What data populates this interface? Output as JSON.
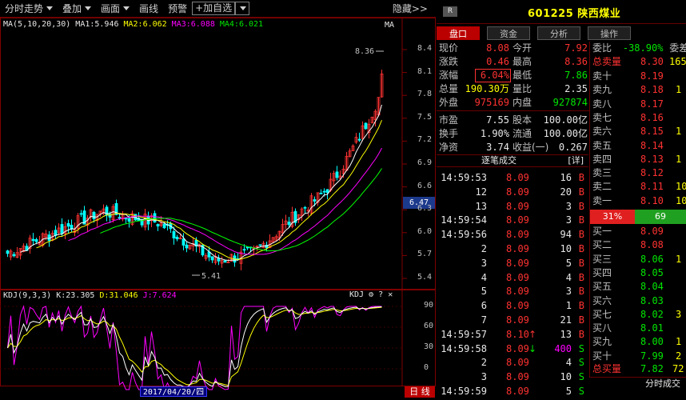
{
  "toolbar": {
    "items": [
      "分时走势",
      "叠加",
      "画面",
      "画线",
      "预警"
    ],
    "add_watch": "+加自选",
    "hide": "隐藏>>"
  },
  "chart": {
    "ma_legend": {
      "params": "MA(5,10,20,30)",
      "ma1": "MA1:5.946",
      "ma2": "MA2:6.062",
      "ma3": "MA3:6.088",
      "ma4": "MA4:6.021",
      "tag": "MA"
    },
    "price_axis": [
      "8.4",
      "8.1",
      "7.8",
      "7.5",
      "7.2",
      "6.9",
      "6.6",
      "6.3",
      "6.0",
      "5.7",
      "5.4"
    ],
    "current_price_tag": "6.47",
    "high_label": "8.36",
    "low_label": "5.41",
    "kdj_legend": {
      "params": "KDJ(9,3,3)",
      "k": "K:23.305",
      "d": "D:31.046",
      "j": "J:7.624"
    },
    "kdj_axis": [
      "90",
      "60",
      "30",
      "0"
    ],
    "date_label": "2017/04/20/四",
    "period_label": "日 线",
    "colors": {
      "ma1": "#ffffff",
      "ma2": "#ffff00",
      "ma3": "#ff00ff",
      "ma4": "#00ff00",
      "up": "#ff3232",
      "down": "#00ffff"
    }
  },
  "header": {
    "badge": "R",
    "title": "601225 陕西煤业"
  },
  "tabs": [
    "盘口",
    "资金",
    "分析",
    "操作"
  ],
  "quote": {
    "rows": [
      {
        "l1": "现价",
        "v1": "8.08",
        "l2": "今开",
        "v2": "7.92"
      },
      {
        "l1": "涨跌",
        "v1": "0.46",
        "l2": "最高",
        "v2": "8.36"
      },
      {
        "l1": "涨幅",
        "v1": "6.04%",
        "l2": "最低",
        "v2": "7.86"
      },
      {
        "l1": "总量",
        "v1": "190.30万",
        "l2": "量比",
        "v2": "2.35"
      },
      {
        "l1": "外盘",
        "v1": "975169",
        "l2": "内盘",
        "v2": "927874"
      },
      {
        "l1": "市盈",
        "v1": "7.55",
        "l2": "股本",
        "v2": "100.00亿"
      },
      {
        "l1": "换手",
        "v1": "1.90%",
        "l2": "流通",
        "v2": "100.00亿"
      },
      {
        "l1": "净资",
        "v1": "3.74",
        "l2": "收益(一)",
        "v2": "0.267"
      }
    ]
  },
  "ticks": {
    "header": "逐笔成交",
    "detail": "[详]",
    "rows": [
      {
        "time": "14:59:53",
        "price": "8.09",
        "vol": "16",
        "bs": "B"
      },
      {
        "time": "12",
        "price": "8.09",
        "vol": "20",
        "bs": "B"
      },
      {
        "time": "13",
        "price": "8.09",
        "vol": "3",
        "bs": "B"
      },
      {
        "time": "14:59:54",
        "price": "8.09",
        "vol": "3",
        "bs": "B"
      },
      {
        "time": "14:59:56",
        "price": "8.09",
        "vol": "94",
        "bs": "B"
      },
      {
        "time": "2",
        "price": "8.09",
        "vol": "10",
        "bs": "B"
      },
      {
        "time": "3",
        "price": "8.09",
        "vol": "5",
        "bs": "B"
      },
      {
        "time": "4",
        "price": "8.09",
        "vol": "4",
        "bs": "B"
      },
      {
        "time": "5",
        "price": "8.09",
        "vol": "3",
        "bs": "B"
      },
      {
        "time": "6",
        "price": "8.09",
        "vol": "1",
        "bs": "B"
      },
      {
        "time": "7",
        "price": "8.09",
        "vol": "21",
        "bs": "B"
      },
      {
        "time": "14:59:57",
        "price": "8.10",
        "vol": "13",
        "bs": "B",
        "arrow": "↑"
      },
      {
        "time": "14:59:58",
        "price": "8.09",
        "vol": "400",
        "bs": "S",
        "arrow": "↓"
      },
      {
        "time": "2",
        "price": "8.09",
        "vol": "4",
        "bs": "S"
      },
      {
        "time": "3",
        "price": "8.09",
        "vol": "10",
        "bs": "S"
      },
      {
        "time": "14:59:59",
        "price": "8.09",
        "vol": "5",
        "bs": "S"
      }
    ]
  },
  "orderbook": {
    "weibi_label": "委比",
    "weibi_value": "-38.90%",
    "weicha_label": "委差",
    "ask_total_label": "总卖量",
    "ask_total_price": "8.30",
    "ask_total_vol": "165",
    "asks": [
      {
        "label": "卖十",
        "price": "8.19",
        "vol": ""
      },
      {
        "label": "卖九",
        "price": "8.18",
        "vol": "1"
      },
      {
        "label": "卖八",
        "price": "8.17",
        "vol": ""
      },
      {
        "label": "卖七",
        "price": "8.16",
        "vol": ""
      },
      {
        "label": "卖六",
        "price": "8.15",
        "vol": "1"
      },
      {
        "label": "卖五",
        "price": "8.14",
        "vol": ""
      },
      {
        "label": "卖四",
        "price": "8.13",
        "vol": "1"
      },
      {
        "label": "卖三",
        "price": "8.12",
        "vol": ""
      },
      {
        "label": "卖二",
        "price": "8.11",
        "vol": "10"
      },
      {
        "label": "卖一",
        "price": "8.10",
        "vol": "10"
      }
    ],
    "bid_pct": "31%",
    "ask_pct": "69",
    "bids": [
      {
        "label": "买一",
        "price": "8.09",
        "vol": ""
      },
      {
        "label": "买二",
        "price": "8.08",
        "vol": ""
      },
      {
        "label": "买三",
        "price": "8.06",
        "vol": "1"
      },
      {
        "label": "买四",
        "price": "8.05",
        "vol": ""
      },
      {
        "label": "买五",
        "price": "8.04",
        "vol": ""
      },
      {
        "label": "买六",
        "price": "8.03",
        "vol": ""
      },
      {
        "label": "买七",
        "price": "8.02",
        "vol": "3"
      },
      {
        "label": "买八",
        "price": "8.01",
        "vol": ""
      },
      {
        "label": "买九",
        "price": "8.00",
        "vol": "1"
      },
      {
        "label": "买十",
        "price": "7.99",
        "vol": "2"
      }
    ],
    "bid_total_label": "总买量",
    "bid_total_price": "7.82",
    "bid_total_vol": "72",
    "ts_button": "分时成交"
  }
}
